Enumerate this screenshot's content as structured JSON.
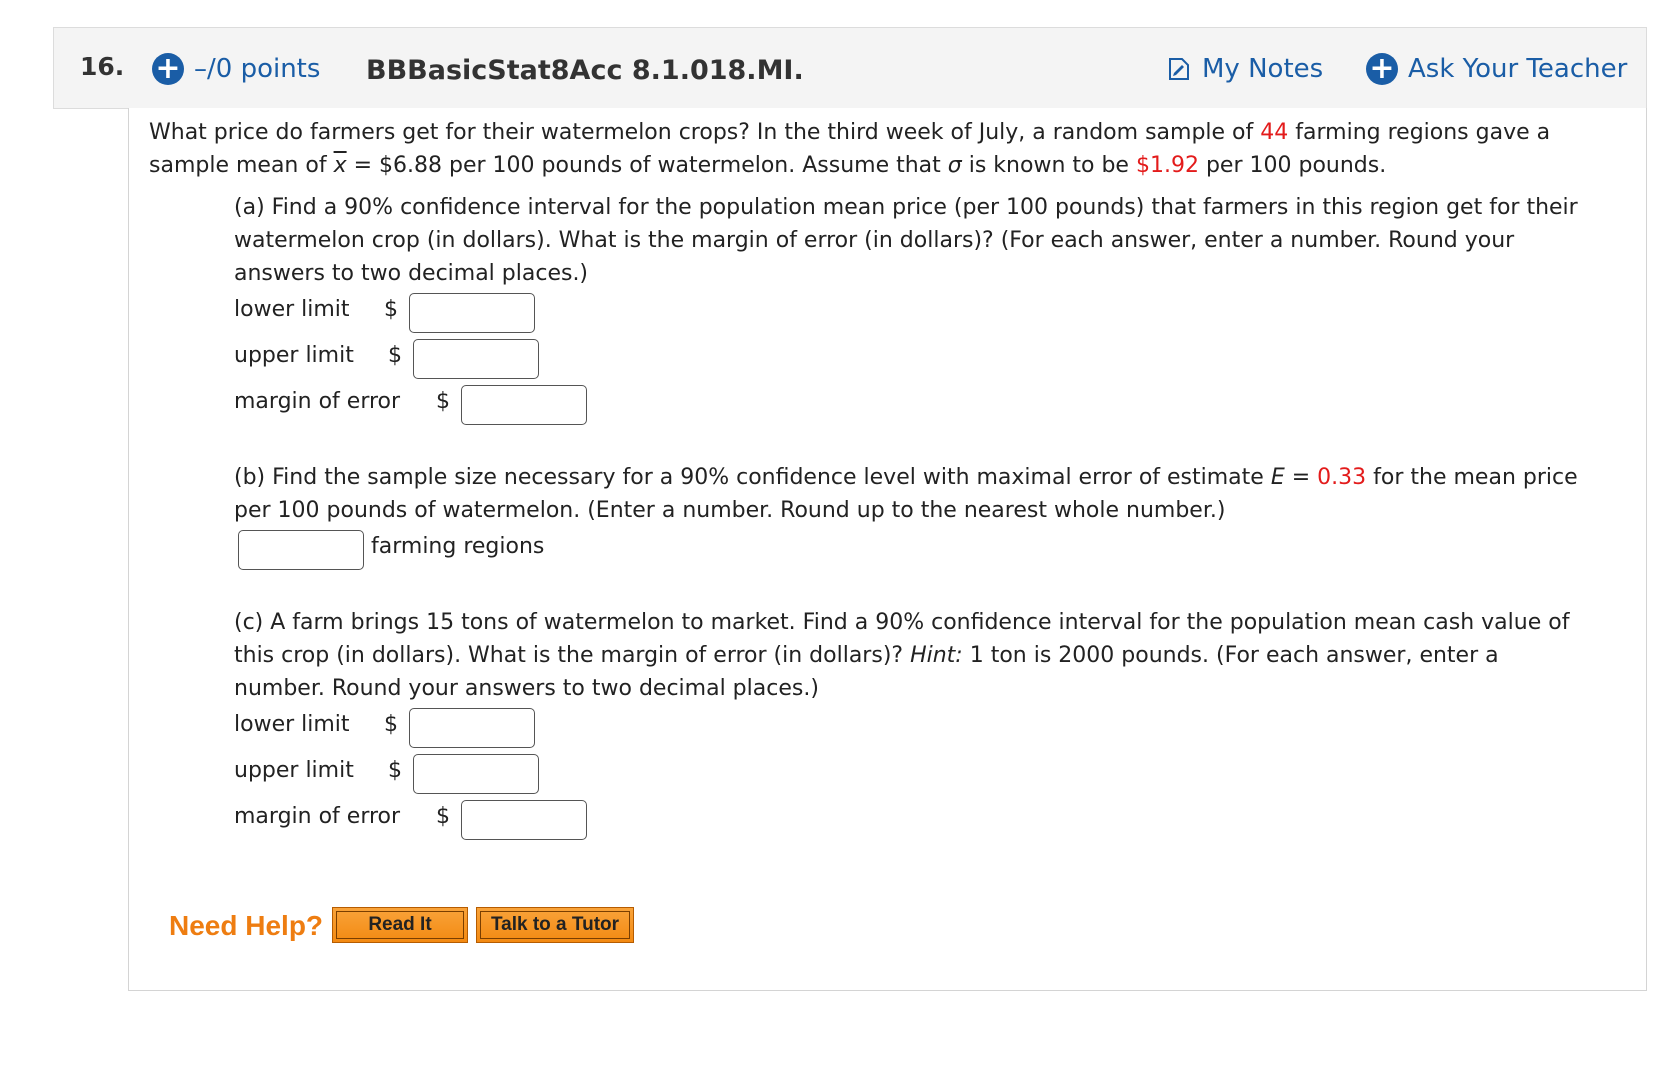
{
  "header": {
    "question_number": "16.",
    "points": "–/0 points",
    "question_id": "BBBasicStat8Acc 8.1.018.MI.",
    "my_notes": "My Notes",
    "ask_teacher": "Ask Your Teacher"
  },
  "intro": {
    "l1_a": "What price do farmers get for their watermelon crops? In the third week of July, a random sample of",
    "n": "44",
    "l1_b": "farming regions gave a",
    "l2_a": "sample mean of",
    "xbar": "x",
    "l2_b": "= $6.88 per 100 pounds of watermelon. Assume that",
    "sigma": "σ",
    "l2_c": "is known to be",
    "sigma_val": "$1.92",
    "l2_d": "per 100 pounds."
  },
  "part_a": {
    "line1": "(a) Find a 90% confidence interval for the population mean price (per 100 pounds) that farmers in this region get for their",
    "line2": "watermelon crop (in dollars). What is the margin of error (in dollars)? (For each answer, enter a number. Round your",
    "line3": "answers to two decimal places.)",
    "lower_label": "lower limit",
    "upper_label": "upper limit",
    "moe_label": "margin of error",
    "currency": "$"
  },
  "part_b": {
    "line1_a": "(b) Find the sample size necessary for a 90% confidence level with maximal error of estimate",
    "e_symbol": "E",
    "line1_eq": "=",
    "e_value": "0.33",
    "line1_b": "for the mean price",
    "line2": "per 100 pounds of watermelon. (Enter a number. Round up to the nearest whole number.)",
    "unit": "farming regions"
  },
  "part_c": {
    "line1": "(c) A farm brings 15 tons of watermelon to market. Find a 90% confidence interval for the population mean cash value of",
    "line2_a": "this crop (in dollars). What is the margin of error (in dollars)?",
    "hint": "Hint:",
    "line2_b": "1 ton is 2000 pounds. (For each answer, enter a",
    "line3": "number. Round your answers to two decimal places.)",
    "lower_label": "lower limit",
    "upper_label": "upper limit",
    "moe_label": "margin of error",
    "currency": "$"
  },
  "help": {
    "need_help": "Need Help?",
    "read_it": "Read It",
    "talk_tutor": "Talk to a Tutor"
  }
}
